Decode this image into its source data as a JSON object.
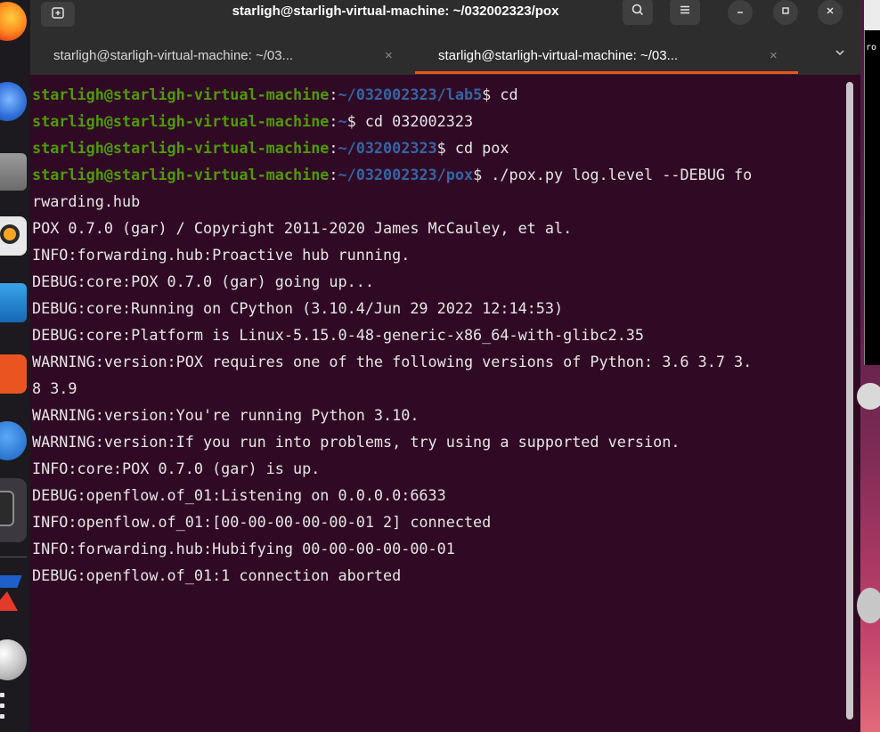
{
  "window": {
    "title": "starligh@starligh-virtual-machine: ~/032002323/pox"
  },
  "tabs": [
    {
      "label": "starligh@starligh-virtual-machine: ~/03...",
      "close": "×",
      "active": false
    },
    {
      "label": "starligh@starligh-virtual-machine: ~/03...",
      "close": "×",
      "active": true
    }
  ],
  "titlebar_icons": {
    "new_tab": "new-tab-icon",
    "search": "search-icon",
    "menu": "hamburger-menu-icon",
    "minimize": "minimize-icon",
    "maximize": "maximize-icon",
    "close": "close-icon",
    "tab_list": "chevron-down-icon"
  },
  "terminal": {
    "prompts": [
      {
        "user": "starligh@starligh-virtual-machine",
        "colon": ":",
        "path": "~/032002323/lab5",
        "cmd": "$ cd"
      },
      {
        "user": "starligh@starligh-virtual-machine",
        "colon": ":",
        "path": "~",
        "cmd": "$ cd 032002323"
      },
      {
        "user": "starligh@starligh-virtual-machine",
        "colon": ":",
        "path": "~/032002323",
        "cmd": "$ cd pox"
      },
      {
        "user": "starligh@starligh-virtual-machine",
        "colon": ":",
        "path": "~/032002323/pox",
        "cmd": "$ ./pox.py log.level --DEBUG fo"
      }
    ],
    "output": [
      "rwarding.hub",
      "POX 0.7.0 (gar) / Copyright 2011-2020 James McCauley, et al.",
      "INFO:forwarding.hub:Proactive hub running.",
      "DEBUG:core:POX 0.7.0 (gar) going up...",
      "DEBUG:core:Running on CPython (3.10.4/Jun 29 2022 12:14:53)",
      "DEBUG:core:Platform is Linux-5.15.0-48-generic-x86_64-with-glibc2.35",
      "WARNING:version:POX requires one of the following versions of Python: 3.6 3.7 3.",
      "8 3.9",
      "WARNING:version:You're running Python 3.10.",
      "WARNING:version:If you run into problems, try using a supported version.",
      "INFO:core:POX 0.7.0 (gar) is up.",
      "DEBUG:openflow.of_01:Listening on 0.0.0.0:6633",
      "INFO:openflow.of_01:[00-00-00-00-00-01 2] connected",
      "INFO:forwarding.hub:Hubifying 00-00-00-00-00-01",
      "DEBUG:openflow.of_01:1 connection aborted"
    ]
  },
  "background_window": {
    "text": "ro"
  },
  "colors": {
    "terminal_bg": "#300a24",
    "prompt_user": "#4e9a06",
    "prompt_path": "#3465a4",
    "tab_accent": "#e95420"
  },
  "dock_icons": [
    "firefox-icon",
    "thunderbird-icon",
    "files-icon",
    "rhythmbox-icon",
    "libreoffice-writer-icon",
    "software-center-icon",
    "help-icon",
    "terminal-icon",
    "wireshark-icon",
    "disk-icon",
    "show-apps-icon"
  ]
}
